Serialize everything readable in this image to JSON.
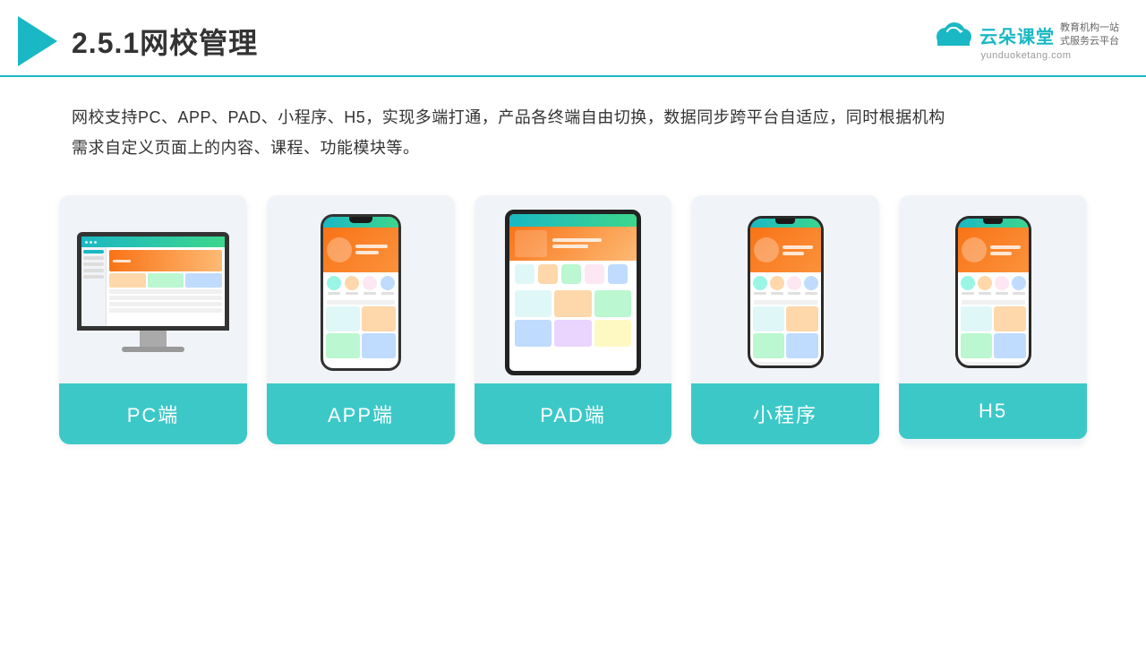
{
  "header": {
    "title": "2.5.1网校管理",
    "title_num": "2.5.1",
    "title_text": "网校管理"
  },
  "logo": {
    "brand": "云朵课堂",
    "url": "yunduoketang.com",
    "slogan1": "教育机构一站",
    "slogan2": "式服务云平台"
  },
  "description": {
    "line1": "网校支持PC、APP、PAD、小程序、H5，实现多端打通，产品各终端自由切换，数据同步跨平台自适应，同时根据机构",
    "line2": "需求自定义页面上的内容、课程、功能模块等。"
  },
  "cards": [
    {
      "id": "pc",
      "label": "PC端"
    },
    {
      "id": "app",
      "label": "APP端"
    },
    {
      "id": "pad",
      "label": "PAD端"
    },
    {
      "id": "miniapp",
      "label": "小程序"
    },
    {
      "id": "h5",
      "label": "H5"
    }
  ]
}
